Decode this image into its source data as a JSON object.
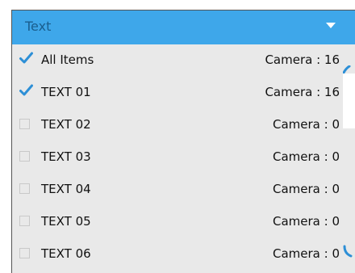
{
  "dropdown": {
    "title": "Text",
    "caret_icon": "chevron-down-icon",
    "accent_color": "#3ea7ea"
  },
  "items": [
    {
      "label": "All Items",
      "count": "Camera : 16",
      "checked": true
    },
    {
      "label": "TEXT 01",
      "count": "Camera : 16",
      "checked": true
    },
    {
      "label": "TEXT 02",
      "count": "Camera : 0",
      "checked": false
    },
    {
      "label": "TEXT 03",
      "count": "Camera : 0",
      "checked": false
    },
    {
      "label": "TEXT 04",
      "count": "Camera : 0",
      "checked": false
    },
    {
      "label": "TEXT 05",
      "count": "Camera : 0",
      "checked": false
    },
    {
      "label": "TEXT 06",
      "count": "Camera : 0",
      "checked": false
    }
  ],
  "scrollbar": {
    "up_icon": "scroll-up-icon",
    "down_icon": "scroll-down-icon"
  }
}
